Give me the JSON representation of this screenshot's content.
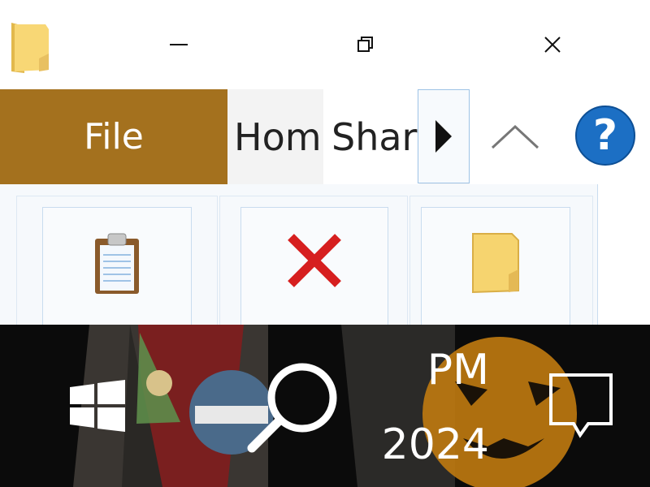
{
  "window": {
    "app_icon": "folder-icon",
    "controls": {
      "minimize": "minimize-icon",
      "maximize": "restore-icon",
      "close": "close-icon"
    }
  },
  "ribbon": {
    "tabs": [
      {
        "label": "File",
        "active": false
      },
      {
        "label": "Home",
        "active": false
      },
      {
        "label": "Share",
        "active": true
      }
    ],
    "scroll_icon": "triangle-right-icon",
    "collapse_icon": "chevron-up-icon",
    "help_label": "?",
    "buttons": [
      {
        "icon": "clipboard-icon"
      },
      {
        "icon": "delete-x-icon"
      },
      {
        "icon": "folder-icon"
      }
    ]
  },
  "taskbar": {
    "time": "PM",
    "date": "2024",
    "start_icon": "windows-logo-icon",
    "search_icon": "search-icon",
    "notification_icon": "action-center-icon",
    "colors": {
      "background": "#000000",
      "file_tab": "#a4711e",
      "help_button": "#1c6fc4"
    }
  }
}
